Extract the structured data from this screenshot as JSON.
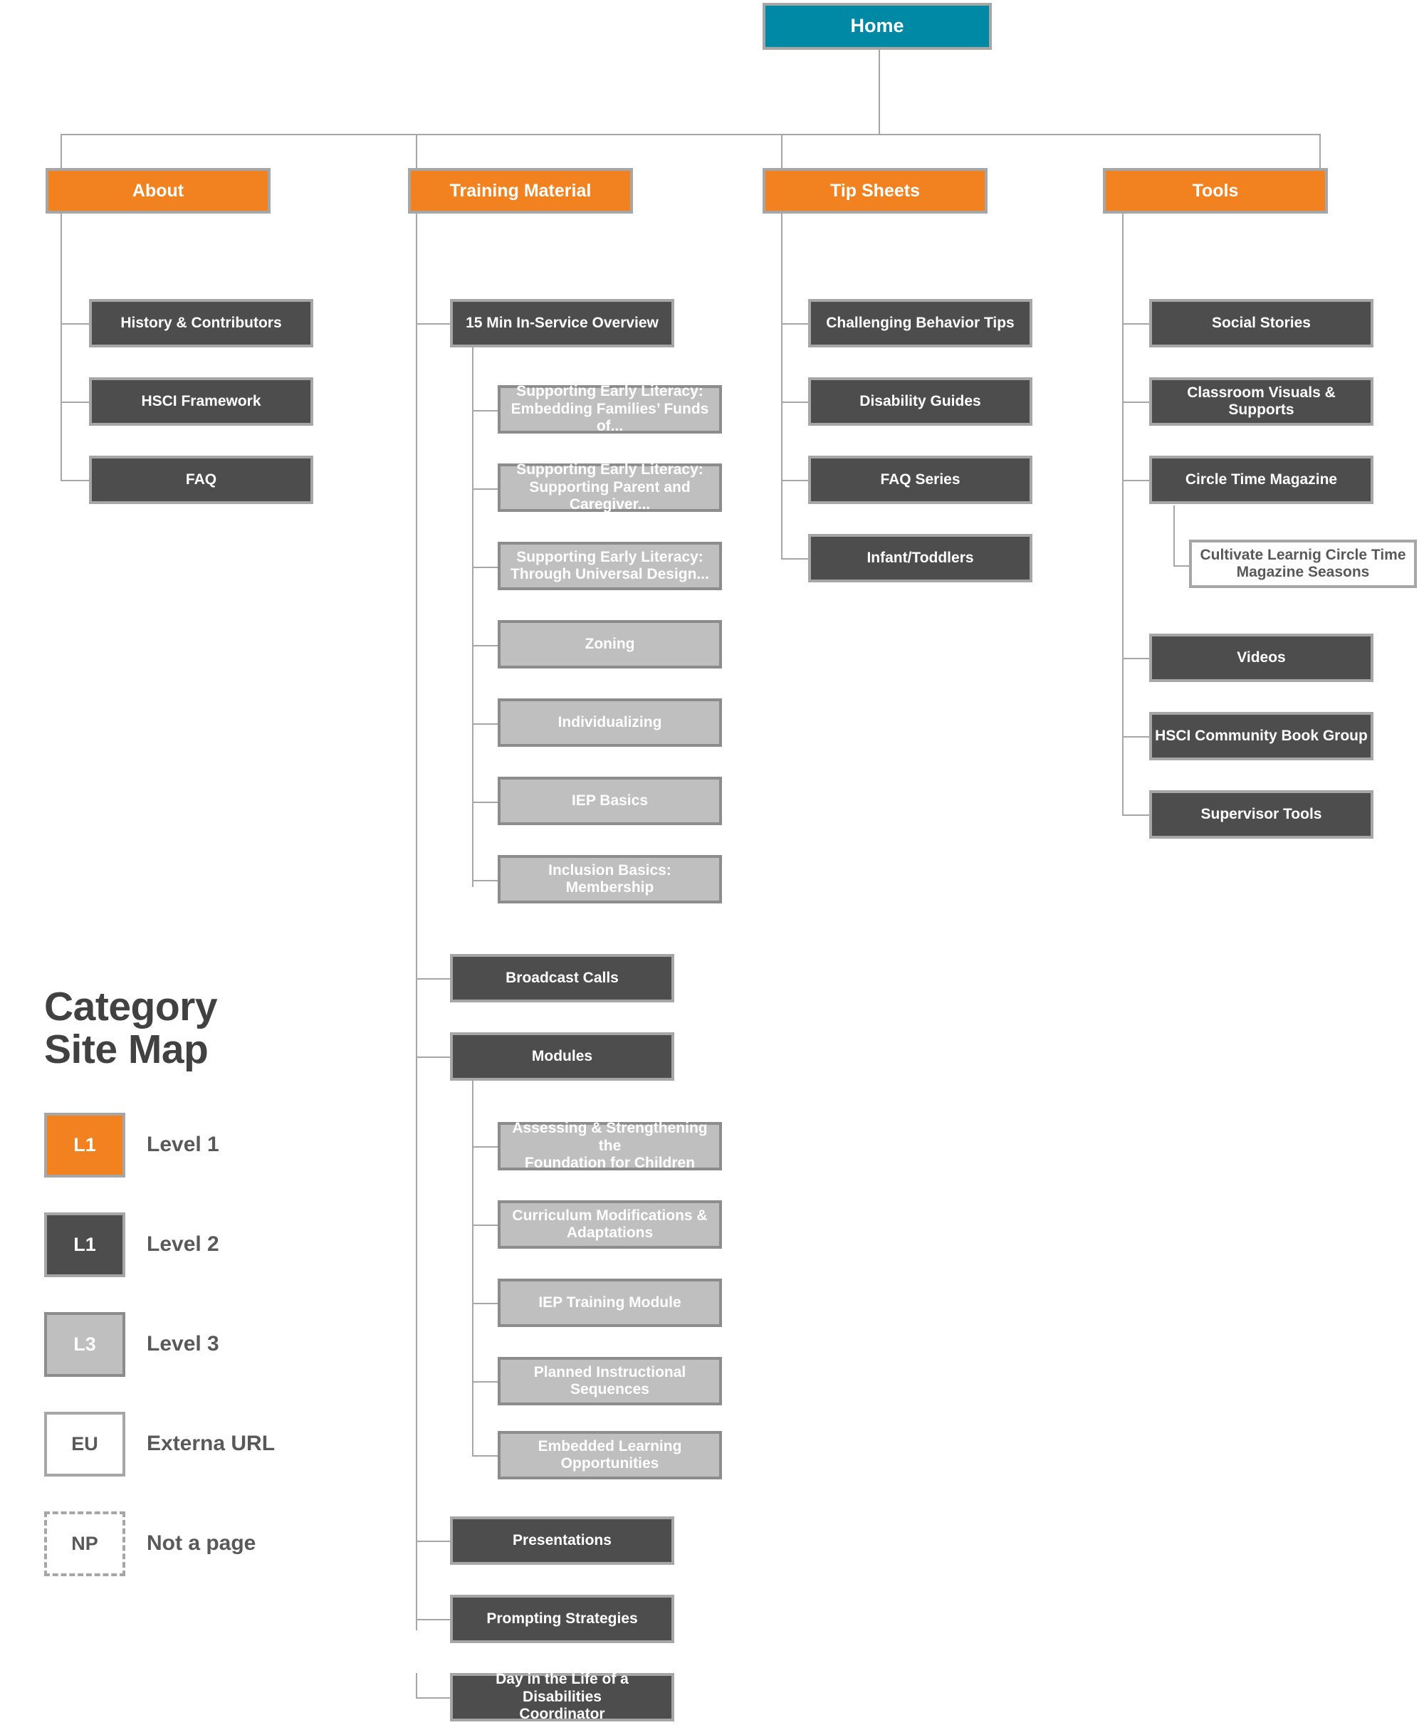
{
  "title": "Category\nSite Map",
  "colors": {
    "home": "#0089a5",
    "level1": "#f2821f",
    "level2": "#4d4d4d",
    "level3": "#bfbfbf",
    "external_url": "#ffffff",
    "line": "#a6a6a6",
    "title_text": "#414141"
  },
  "root": {
    "label": "Home",
    "level": "home"
  },
  "branches": [
    {
      "label": "About",
      "level": "level1",
      "children": [
        {
          "label": "History & Contributors",
          "level": "level2"
        },
        {
          "label": "HSCI Framework",
          "level": "level2"
        },
        {
          "label": "FAQ",
          "level": "level2"
        }
      ]
    },
    {
      "label": "Training Material",
      "level": "level1",
      "children": [
        {
          "label": "15 Min In-Service Overview",
          "level": "level2",
          "children": [
            {
              "label": "Supporting Early Literacy:\nEmbedding Families’ Funds of...",
              "level": "level3"
            },
            {
              "label": "Supporting Early Literacy:\nSupporting Parent and Caregiver...",
              "level": "level3"
            },
            {
              "label": "Supporting Early Literacy:\nThrough Universal Design...",
              "level": "level3"
            },
            {
              "label": "Zoning",
              "level": "level3"
            },
            {
              "label": "Individualizing",
              "level": "level3"
            },
            {
              "label": "IEP Basics",
              "level": "level3"
            },
            {
              "label": "Inclusion Basics: Membership",
              "level": "level3"
            }
          ]
        },
        {
          "label": "Broadcast Calls",
          "level": "level2"
        },
        {
          "label": "Modules",
          "level": "level2",
          "children": [
            {
              "label": "Assessing & Strengthening the\nFoundation for Children",
              "level": "level3"
            },
            {
              "label": "Curriculum Modifications &\nAdaptations",
              "level": "level3"
            },
            {
              "label": "IEP Training Module",
              "level": "level3"
            },
            {
              "label": "Planned Instructional Sequences",
              "level": "level3"
            },
            {
              "label": "Embedded Learning\nOpportunities",
              "level": "level3"
            }
          ]
        },
        {
          "label": "Presentations",
          "level": "level2"
        },
        {
          "label": "Prompting Strategies",
          "level": "level2"
        },
        {
          "label": "Day in the Life of a Disabilities\nCoordinator",
          "level": "level2"
        }
      ]
    },
    {
      "label": "Tip Sheets",
      "level": "level1",
      "children": [
        {
          "label": "Challenging Behavior Tips",
          "level": "level2"
        },
        {
          "label": "Disability Guides",
          "level": "level2"
        },
        {
          "label": "FAQ Series",
          "level": "level2"
        },
        {
          "label": "Infant/Toddlers",
          "level": "level2"
        }
      ]
    },
    {
      "label": "Tools",
      "level": "level1",
      "children": [
        {
          "label": "Social Stories",
          "level": "level2"
        },
        {
          "label": "Classroom Visuals & Supports",
          "level": "level2"
        },
        {
          "label": "Circle Time Magazine",
          "level": "level2",
          "children": [
            {
              "label": "Cultivate Learnig Circle Time\nMagazine Seasons",
              "level": "external_url"
            }
          ]
        },
        {
          "label": "Videos",
          "level": "level2"
        },
        {
          "label": "HSCI Community Book Group",
          "level": "level2"
        },
        {
          "label": "Supervisor Tools",
          "level": "level2"
        }
      ]
    }
  ],
  "legend": [
    {
      "code": "L1",
      "label": "Level 1",
      "style": "level1"
    },
    {
      "code": "L1",
      "label": "Level 2",
      "style": "level2"
    },
    {
      "code": "L3",
      "label": "Level 3",
      "style": "level3"
    },
    {
      "code": "EU",
      "label": "Externa URL",
      "style": "external_url"
    },
    {
      "code": "NP",
      "label": "Not a page",
      "style": "not_a_page"
    }
  ]
}
